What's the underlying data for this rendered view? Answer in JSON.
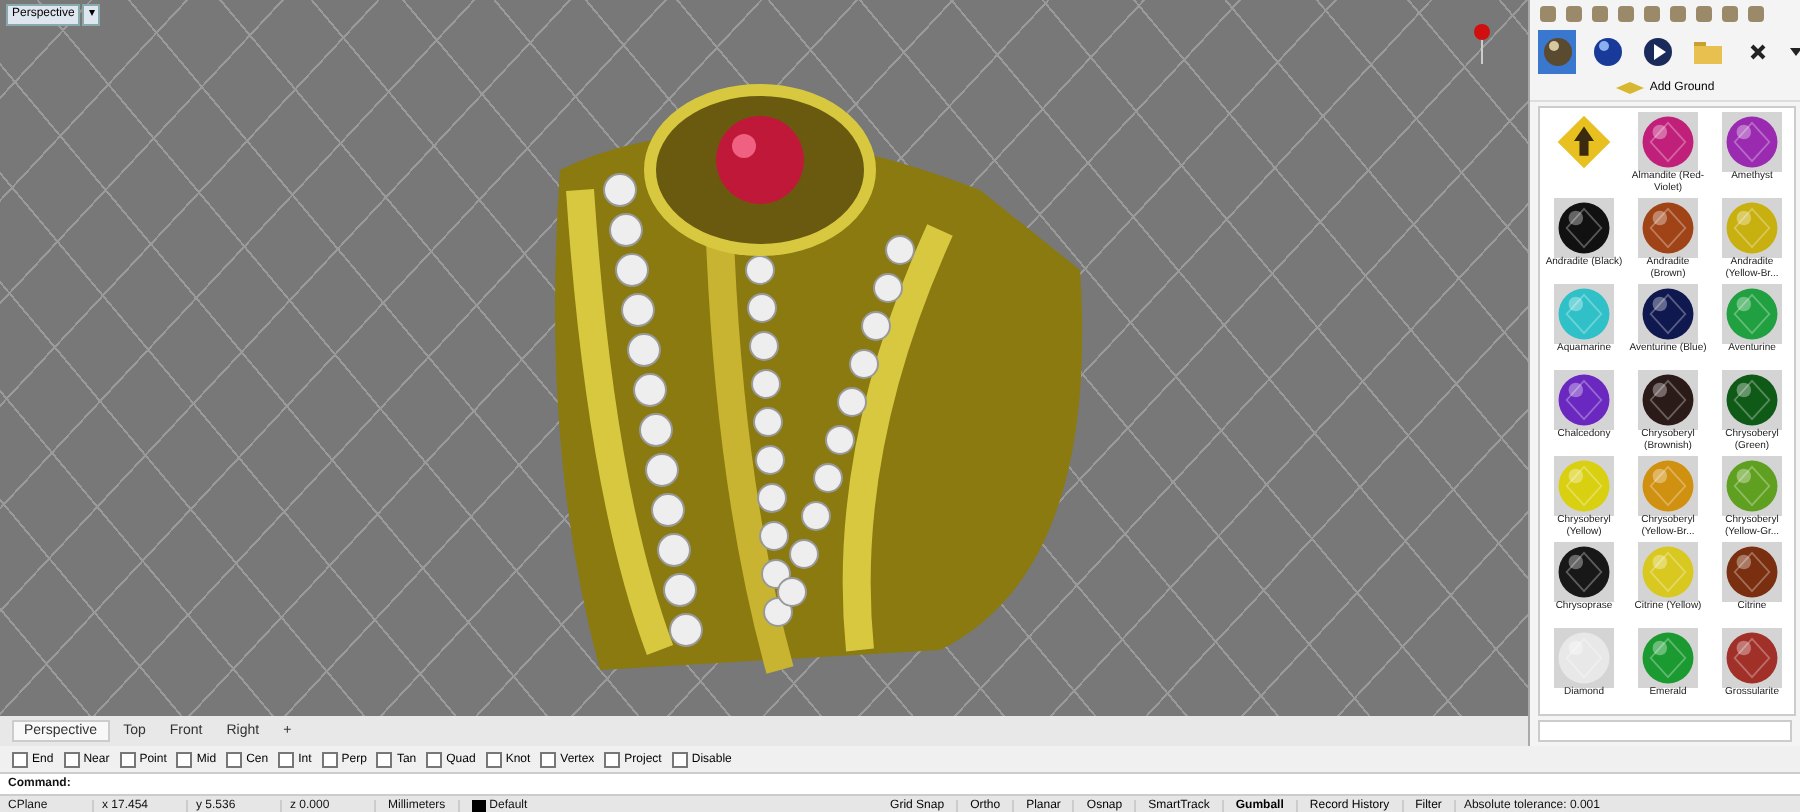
{
  "viewport": {
    "label": "Perspective",
    "menu_glyph": "▾"
  },
  "viewport_tabs": [
    {
      "label": "Perspective",
      "selected": true
    },
    {
      "label": "Top",
      "selected": false
    },
    {
      "label": "Front",
      "selected": false
    },
    {
      "label": "Right",
      "selected": false
    },
    {
      "label": "+",
      "selected": false
    }
  ],
  "osnaps": [
    {
      "label": "End",
      "checked": false
    },
    {
      "label": "Near",
      "checked": false
    },
    {
      "label": "Point",
      "checked": false
    },
    {
      "label": "Mid",
      "checked": false
    },
    {
      "label": "Cen",
      "checked": false
    },
    {
      "label": "Int",
      "checked": false
    },
    {
      "label": "Perp",
      "checked": false
    },
    {
      "label": "Tan",
      "checked": false
    },
    {
      "label": "Quad",
      "checked": false
    },
    {
      "label": "Knot",
      "checked": false
    },
    {
      "label": "Vertex",
      "checked": false
    },
    {
      "label": "Project",
      "checked": false
    },
    {
      "label": "Disable",
      "checked": false
    }
  ],
  "command": {
    "label": "Command:"
  },
  "status_bar": {
    "coords": [
      "CPlane",
      "x 17.454",
      "y 5.536",
      "z 0.000"
    ],
    "units": "Millimeters",
    "layer": "Default",
    "toggles": [
      {
        "label": "Grid Snap",
        "on": false
      },
      {
        "label": "Ortho",
        "on": false
      },
      {
        "label": "Planar",
        "on": false
      },
      {
        "label": "Osnap",
        "on": false
      },
      {
        "label": "SmartTrack",
        "on": false
      },
      {
        "label": "Gumball",
        "on": true
      },
      {
        "label": "Record History",
        "on": false
      },
      {
        "label": "Filter",
        "on": false
      }
    ],
    "tolerance": "Absolute tolerance: 0.001"
  },
  "panel": {
    "tabs": [
      {
        "kind": "material",
        "selected": true
      },
      {
        "kind": "environment",
        "selected": false
      },
      {
        "kind": "render",
        "selected": false
      },
      {
        "kind": "folder",
        "selected": false
      },
      {
        "kind": "close",
        "selected": false
      }
    ],
    "add_button": "Add Ground",
    "materials": [
      {
        "kind": "folder"
      },
      {
        "kind": "gem",
        "label": "Almandite (Red-Violet)",
        "color": "#c0207a"
      },
      {
        "kind": "gem",
        "label": "Amethyst",
        "color": "#9a2ab0"
      },
      {
        "kind": "gem",
        "label": "Andradite (Black)",
        "color": "#111111"
      },
      {
        "kind": "gem",
        "label": "Andradite (Brown)",
        "color": "#a04418"
      },
      {
        "kind": "gem",
        "label": "Andradite (Yellow-Br...",
        "color": "#c8b010"
      },
      {
        "kind": "gem",
        "label": "Aquamarine",
        "color": "#30c0c8"
      },
      {
        "kind": "gem",
        "label": "Aventurine (Blue)",
        "color": "#101850"
      },
      {
        "kind": "gem",
        "label": "Aventurine",
        "color": "#20a040"
      },
      {
        "kind": "gem",
        "label": "Chalcedony",
        "color": "#6a28c0"
      },
      {
        "kind": "gem",
        "label": "Chrysoberyl (Brownish)",
        "color": "#2a1a18"
      },
      {
        "kind": "gem",
        "label": "Chrysoberyl (Green)",
        "color": "#105a18"
      },
      {
        "kind": "gem",
        "label": "Chrysoberyl (Yellow)",
        "color": "#d8d010"
      },
      {
        "kind": "gem",
        "label": "Chrysoberyl (Yellow-Br...",
        "color": "#d09010"
      },
      {
        "kind": "gem",
        "label": "Chrysoberyl (Yellow-Gr...",
        "color": "#60a020"
      },
      {
        "kind": "gem",
        "label": "Chrysoprase",
        "color": "#181818"
      },
      {
        "kind": "gem",
        "label": "Citrine (Yellow)",
        "color": "#d8c820"
      },
      {
        "kind": "gem",
        "label": "Citrine",
        "color": "#7a3010"
      },
      {
        "kind": "gem",
        "label": "Diamond",
        "color": "#e8e8e8"
      },
      {
        "kind": "gem",
        "label": "Emerald",
        "color": "#1a9a30"
      },
      {
        "kind": "gem",
        "label": "Grossularite",
        "color": "#a03028"
      }
    ]
  }
}
